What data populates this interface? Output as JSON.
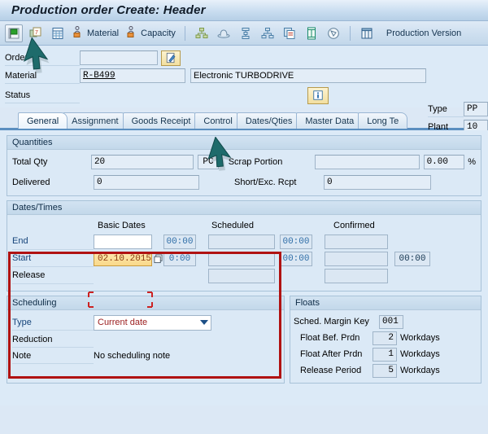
{
  "window": {
    "title": "Production order Create: Header"
  },
  "toolbar": {
    "icons": [
      {
        "name": "save-flag-icon",
        "glyph": "flag"
      },
      {
        "name": "order-document-icon",
        "glyph": "doc7"
      },
      {
        "name": "list-icon",
        "glyph": "list"
      },
      {
        "name": "material-icon",
        "glyph": "person-box"
      },
      {
        "name": "capacity-icon",
        "glyph": "person-box"
      },
      {
        "name": "hierarchy-icon",
        "glyph": "hier"
      },
      {
        "name": "costing-icon",
        "glyph": "hat"
      },
      {
        "name": "sequence-icon",
        "glyph": "seq"
      },
      {
        "name": "network-icon",
        "glyph": "net"
      },
      {
        "name": "copy-icon",
        "glyph": "copy"
      },
      {
        "name": "document-icon",
        "glyph": "book"
      },
      {
        "name": "check-icon",
        "glyph": "circle"
      },
      {
        "name": "table-icon",
        "glyph": "grid"
      }
    ],
    "material_label": "Material",
    "capacity_label": "Capacity",
    "production_version_label": "Production Version"
  },
  "header": {
    "order": {
      "label": "Order",
      "value": ""
    },
    "order_edit_icon": "pencil-icon",
    "material": {
      "label": "Material",
      "value": "R-B499",
      "description": "Electronic TURBODRIVE"
    },
    "status": {
      "label": "Status",
      "value": ""
    },
    "status_info_icon": "info-icon",
    "type": {
      "label": "Type",
      "value": "PP"
    },
    "plant": {
      "label": "Plant",
      "value": "10"
    }
  },
  "tabs": [
    {
      "label": "General",
      "active": true
    },
    {
      "label": "Assignment",
      "active": false
    },
    {
      "label": "Goods Receipt",
      "active": false
    },
    {
      "label": "Control",
      "active": false
    },
    {
      "label": "Dates/Qties",
      "active": false
    },
    {
      "label": "Master Data",
      "active": false
    },
    {
      "label": "Long Te",
      "active": false
    }
  ],
  "quantities": {
    "group_title": "Quantities",
    "total_qty": {
      "label": "Total Qty",
      "value": "20",
      "uom": "PC"
    },
    "delivered": {
      "label": "Delivered",
      "value": "0"
    },
    "scrap_portion": {
      "label": "Scrap Portion",
      "value": "",
      "percent": "0.00",
      "percent_sign": "%"
    },
    "short_exc_rcpt": {
      "label": "Short/Exc. Rcpt",
      "value": "0"
    }
  },
  "dates_times": {
    "group_title": "Dates/Times",
    "columns": [
      "Basic Dates",
      "Scheduled",
      "Confirmed"
    ],
    "rows": [
      {
        "label": "End",
        "basic_date": "",
        "basic_time": "00:00",
        "scheduled_date": "",
        "scheduled_time": "00:00",
        "confirmed_date": "",
        "confirmed_time": ""
      },
      {
        "label": "Start",
        "basic_date": "02.10.2015",
        "basic_time": "0:00",
        "scheduled_date": "",
        "scheduled_time": "00:00",
        "confirmed_date": "",
        "confirmed_time": "00:00"
      },
      {
        "label": "Release",
        "basic_date": "",
        "basic_time": "",
        "scheduled_date": "",
        "scheduled_time": "",
        "confirmed_date": "",
        "confirmed_time": ""
      }
    ],
    "date_picker_icon": "calendar-icon"
  },
  "scheduling": {
    "group_title": "Scheduling",
    "type": {
      "label": "Type",
      "value": "Current date"
    },
    "reduction": {
      "label": "Reduction",
      "value": ""
    },
    "note": {
      "label": "Note",
      "value": "No scheduling note"
    }
  },
  "floats": {
    "group_title": "Floats",
    "sched_margin_key": {
      "label": "Sched. Margin Key",
      "value": "001"
    },
    "float_bef_prdn": {
      "label": "Float Bef. Prdn",
      "value": "2",
      "unit": "Workdays"
    },
    "float_after_prdn": {
      "label": "Float After Prdn",
      "value": "1",
      "unit": "Workdays"
    },
    "release_period": {
      "label": "Release Period",
      "value": "5",
      "unit": "Workdays"
    }
  },
  "annotations": {
    "highlight_color": "#b01212",
    "cursor_color": "#1e6b6b"
  }
}
